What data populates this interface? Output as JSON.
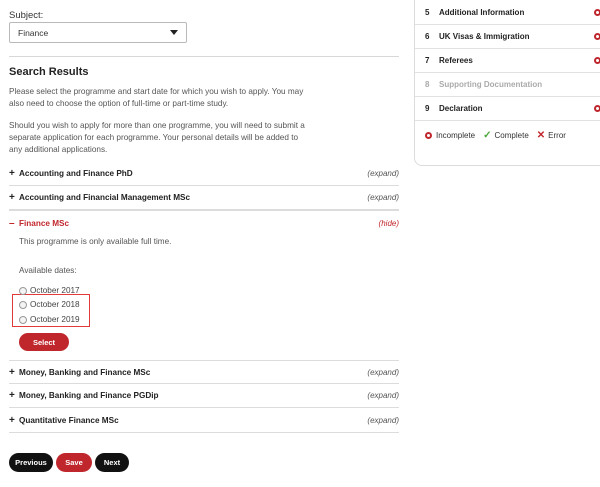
{
  "subject": {
    "label": "Subject:",
    "value": "Finance"
  },
  "results": {
    "heading": "Search Results",
    "intro1": "Please select the programme and start date for which you wish to apply. You may also need to choose the option of full-time or part-time study.",
    "intro2": "Should you wish to apply for more than one programme, you will need to submit a separate application for each programme. Your personal details will be added to any additional applications."
  },
  "programmes": [
    {
      "title": "Accounting and Finance PhD",
      "action": "(expand)"
    },
    {
      "title": "Accounting and Financial Management MSc",
      "action": "(expand)"
    },
    {
      "title": "Finance MSc",
      "action": "(hide)"
    },
    {
      "title": "Money, Banking and Finance MSc",
      "action": "(expand)"
    },
    {
      "title": "Money, Banking and Finance PGDip",
      "action": "(expand)"
    },
    {
      "title": "Quantitative Finance MSc",
      "action": "(expand)"
    }
  ],
  "expanded": {
    "note": "This programme is only available full time.",
    "dates_label": "Available dates:",
    "dates": [
      "October 2017",
      "October 2018",
      "October 2019"
    ],
    "select_label": "Select"
  },
  "buttons": {
    "previous": "Previous",
    "save": "Save",
    "next": "Next"
  },
  "steps": [
    {
      "num": "5",
      "name": "Additional Information"
    },
    {
      "num": "6",
      "name": "UK Visas & Immigration"
    },
    {
      "num": "7",
      "name": "Referees"
    },
    {
      "num": "8",
      "name": "Supporting Documentation"
    },
    {
      "num": "9",
      "name": "Declaration"
    }
  ],
  "legend": {
    "incomplete": "Incomplete",
    "complete": "Complete",
    "error": "Error"
  },
  "colors": {
    "accent": "#c0272d",
    "complete": "#4aa63a",
    "dark": "#111111"
  }
}
